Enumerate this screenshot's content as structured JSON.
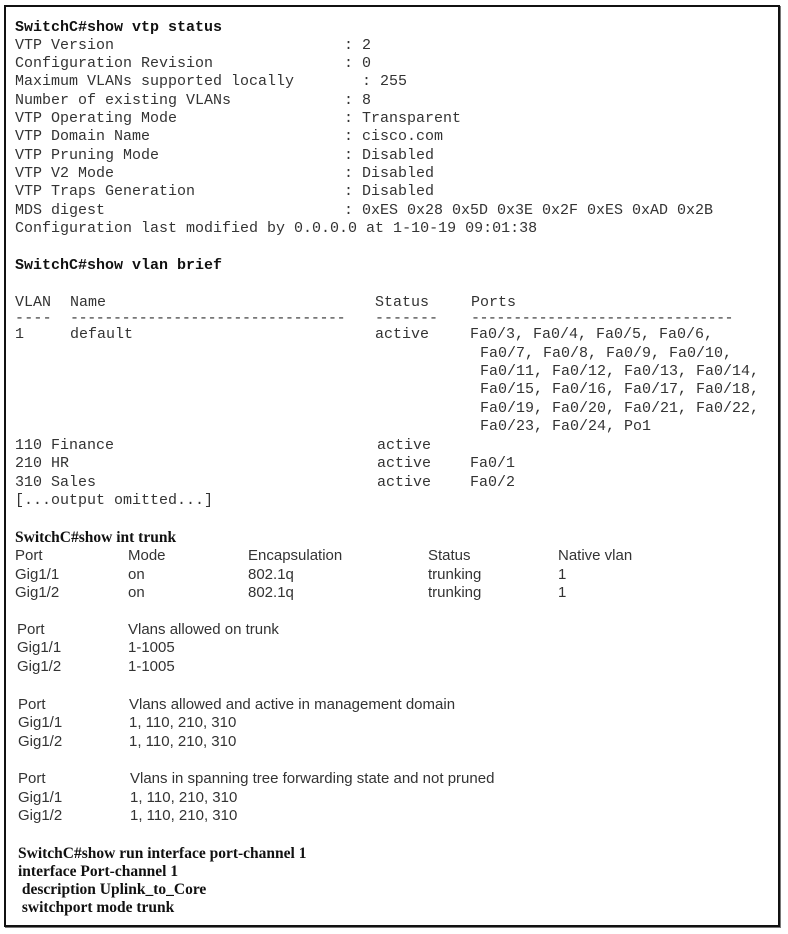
{
  "vtp": {
    "command": "SwitchC#show vtp status",
    "rows": [
      {
        "label": "VTP Version",
        "value": ": 2"
      },
      {
        "label": "Configuration Revision",
        "value": ": 0"
      },
      {
        "label": "Maximum VLANs supported locally",
        "value": ": 255"
      },
      {
        "label": "Number of existing VLANs",
        "value": ": 8"
      },
      {
        "label": "VTP Operating Mode",
        "value": ": Transparent"
      },
      {
        "label": "VTP Domain Name",
        "value": ": cisco.com"
      },
      {
        "label": "VTP Pruning Mode",
        "value": ": Disabled"
      },
      {
        "label": "VTP V2 Mode",
        "value": ": Disabled"
      },
      {
        "label": "VTP Traps Generation",
        "value": ": Disabled"
      },
      {
        "label": "MDS digest",
        "value": ": 0xES 0x28 0x5D 0x3E 0x2F 0xES 0xAD 0x2B"
      }
    ],
    "last_modified": "Configuration last modified by 0.0.0.0 at 1-10-19 09:01:38"
  },
  "vlan_brief": {
    "command": "SwitchC#show vlan brief",
    "headers": {
      "vlan": "VLAN",
      "name": "Name",
      "status": "Status",
      "ports": "Ports"
    },
    "dashes": {
      "vlan": "----",
      "name": "--------------------------------",
      "status": "-------",
      "ports": "-------------------------------"
    },
    "rows": [
      {
        "vlan": "1",
        "name": "default",
        "status": "active",
        "ports": [
          "Fa0/3, Fa0/4, Fa0/5, Fa0/6,",
          "Fa0/7, Fa0/8, Fa0/9, Fa0/10,",
          "Fa0/11, Fa0/12, Fa0/13, Fa0/14,",
          "Fa0/15, Fa0/16, Fa0/17, Fa0/18,",
          "Fa0/19, Fa0/20, Fa0/21, Fa0/22,",
          "Fa0/23, Fa0/24, Po1"
        ]
      },
      {
        "vlan": "110",
        "name": "Finance",
        "status": "active",
        "ports": [
          ""
        ]
      },
      {
        "vlan": "210",
        "name": "HR",
        "status": "active",
        "ports": [
          "Fa0/1"
        ]
      },
      {
        "vlan": "310",
        "name": "Sales",
        "status": "active",
        "ports": [
          "Fa0/2"
        ]
      }
    ],
    "omitted": "[...output omitted...]"
  },
  "int_trunk": {
    "command": "SwitchC#show int trunk",
    "headers": {
      "port": "Port",
      "mode": "Mode",
      "encapsulation": "Encapsulation",
      "status": "Status",
      "native": "Native vlan"
    },
    "rows": [
      {
        "port": "Gig1/1",
        "mode": "on",
        "encapsulation": "802.1q",
        "status": "trunking",
        "native": "1"
      },
      {
        "port": "Gig1/2",
        "mode": "on",
        "encapsulation": "802.1q",
        "status": "trunking",
        "native": "1"
      }
    ],
    "sections": [
      {
        "port_header": "Port",
        "title": "Vlans allowed on trunk",
        "rows": [
          {
            "port": "Gig1/1",
            "value": "1-1005"
          },
          {
            "port": "Gig1/2",
            "value": "1-1005"
          }
        ]
      },
      {
        "port_header": "Port",
        "title": "Vlans allowed and active in management domain",
        "rows": [
          {
            "port": "Gig1/1",
            "value": "1, 110, 210, 310"
          },
          {
            "port": "Gig1/2",
            "value": "1, 110, 210, 310"
          }
        ]
      },
      {
        "port_header": "Port",
        "title": "Vlans in spanning tree forwarding state and not pruned",
        "rows": [
          {
            "port": "Gig1/1",
            "value": "1, 110, 210, 310"
          },
          {
            "port": "Gig1/2",
            "value": "1, 110, 210, 310"
          }
        ]
      }
    ]
  },
  "run_config": {
    "command": "SwitchC#show run interface port-channel 1",
    "lines": [
      "interface Port-channel 1",
      " description Uplink_to_Core",
      " switchport mode trunk"
    ]
  }
}
